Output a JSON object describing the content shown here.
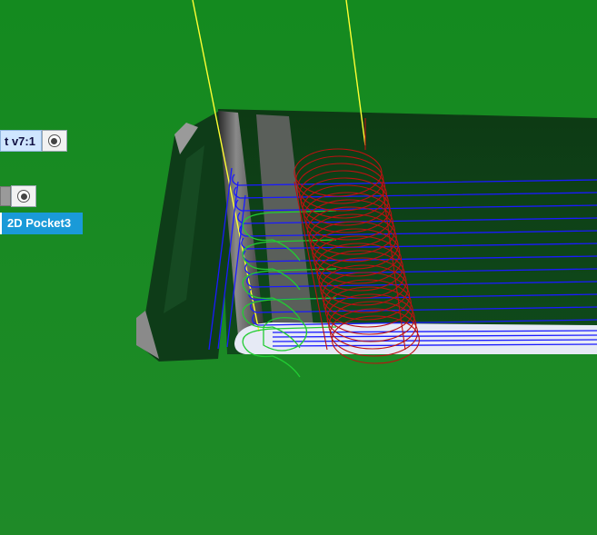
{
  "viewport": {
    "background_color": "#1a8a22",
    "labels": [
      {
        "text": "t v7:1",
        "style": "light"
      },
      {
        "text": "",
        "style": "gray"
      },
      {
        "text": "2D Pocket3",
        "style": "selected"
      }
    ],
    "visibility_icon": "eye-icon"
  },
  "colors": {
    "part_dark": "#0f4a1c",
    "part_face": "#0c3a16",
    "tool_axis": "#ffff33",
    "toolpath_cut": "#1a1aff",
    "toolpath_lead": "#22cc33",
    "helix": "#bb1111",
    "stock_edge": "#e6eaf5"
  }
}
